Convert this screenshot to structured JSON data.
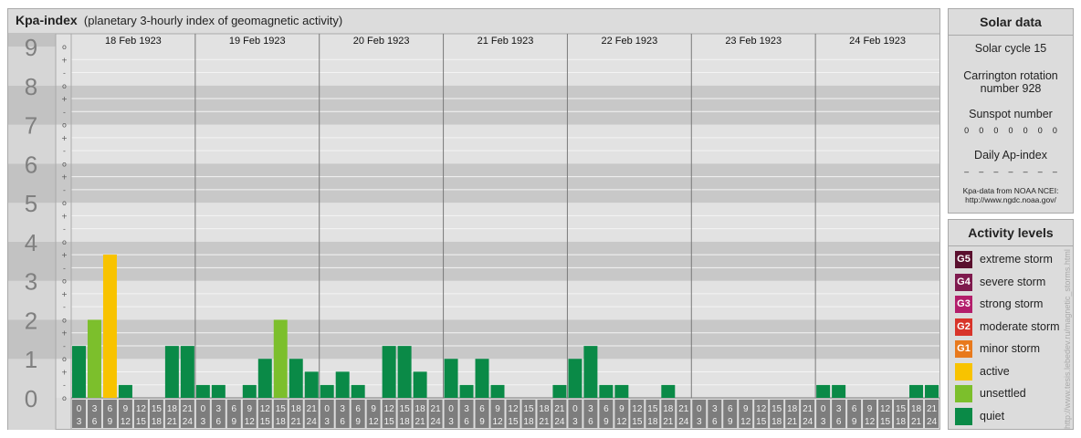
{
  "header": {
    "title": "Kpa-index",
    "subtitle": "(planetary 3-hourly index of geomagnetic activity)"
  },
  "chart_data": {
    "type": "bar",
    "title": "Kpa-index",
    "subtitle": "(planetary 3-hourly index of geomagnetic activity)",
    "ylim": [
      0,
      9
    ],
    "y_ticks": [
      "0",
      "1",
      "2",
      "3",
      "4",
      "5",
      "6",
      "7",
      "8",
      "9"
    ],
    "y_minor_ticks": [
      "o",
      "+",
      "-"
    ],
    "days": [
      {
        "date": "18 Feb 1923",
        "values": [
          1.33,
          2.0,
          3.67,
          0.33,
          0.0,
          0.0,
          1.33,
          1.33
        ]
      },
      {
        "date": "19 Feb 1923",
        "values": [
          0.33,
          0.33,
          0.0,
          0.33,
          1.0,
          2.0,
          1.0,
          0.67
        ]
      },
      {
        "date": "20 Feb 1923",
        "values": [
          0.33,
          0.67,
          0.33,
          0.0,
          1.33,
          1.33,
          0.67,
          0.0
        ]
      },
      {
        "date": "21 Feb 1923",
        "values": [
          1.0,
          0.33,
          1.0,
          0.33,
          0.0,
          0.0,
          0.0,
          0.33
        ]
      },
      {
        "date": "22 Feb 1923",
        "values": [
          1.0,
          1.33,
          0.33,
          0.33,
          0.0,
          0.0,
          0.33,
          0.0
        ]
      },
      {
        "date": "23 Feb 1923",
        "values": [
          0.0,
          0.0,
          0.0,
          0.0,
          0.0,
          0.0,
          0.0,
          0.0
        ]
      },
      {
        "date": "24 Feb 1923",
        "values": [
          0.33,
          0.33,
          0.0,
          0.0,
          0.0,
          0.0,
          0.33,
          0.33
        ]
      }
    ],
    "hour_start": [
      "0",
      "3",
      "6",
      "9",
      "12",
      "15",
      "18",
      "21"
    ],
    "hour_end": [
      "3",
      "6",
      "9",
      "12",
      "15",
      "18",
      "21",
      "24"
    ],
    "colors": {
      "quiet": "#0a8a47",
      "unsettled": "#7cbf2c",
      "active": "#f8c300",
      "band_dark": "#c8c8c8",
      "band_light": "#e2e2e2",
      "axis_label": "#808080"
    }
  },
  "solar": {
    "title": "Solar data",
    "cycle": "Solar cycle 15",
    "carrington_line1": "Carrington rotation",
    "carrington_line2": "number 928",
    "sunspot_label": "Sunspot number",
    "sunspot_values": [
      "0",
      "0",
      "0",
      "0",
      "0",
      "0",
      "0"
    ],
    "ap_label": "Daily Ap-index",
    "ap_values": [
      "–",
      "–",
      "–",
      "–",
      "–",
      "–",
      "–"
    ],
    "credit_line1": "Kpa-data from NOAA NCEI:",
    "credit_line2": "http://www.ngdc.noaa.gov/"
  },
  "activity": {
    "title": "Activity levels",
    "levels": [
      {
        "code": "G5",
        "label": "extreme storm",
        "color": "#5a0f2e"
      },
      {
        "code": "G4",
        "label": "severe storm",
        "color": "#7f1a4e"
      },
      {
        "code": "G3",
        "label": "strong storm",
        "color": "#b31e6b"
      },
      {
        "code": "G2",
        "label": "moderate storm",
        "color": "#d8342a"
      },
      {
        "code": "G1",
        "label": "minor storm",
        "color": "#e8791c"
      },
      {
        "code": "",
        "label": "active",
        "color": "#f8c300"
      },
      {
        "code": "",
        "label": "unsettled",
        "color": "#7cbf2c"
      },
      {
        "code": "",
        "label": "quiet",
        "color": "#0a8a47"
      }
    ]
  },
  "watermark": "http://www.tesis.lebedev.ru/magnetic_storms.html"
}
